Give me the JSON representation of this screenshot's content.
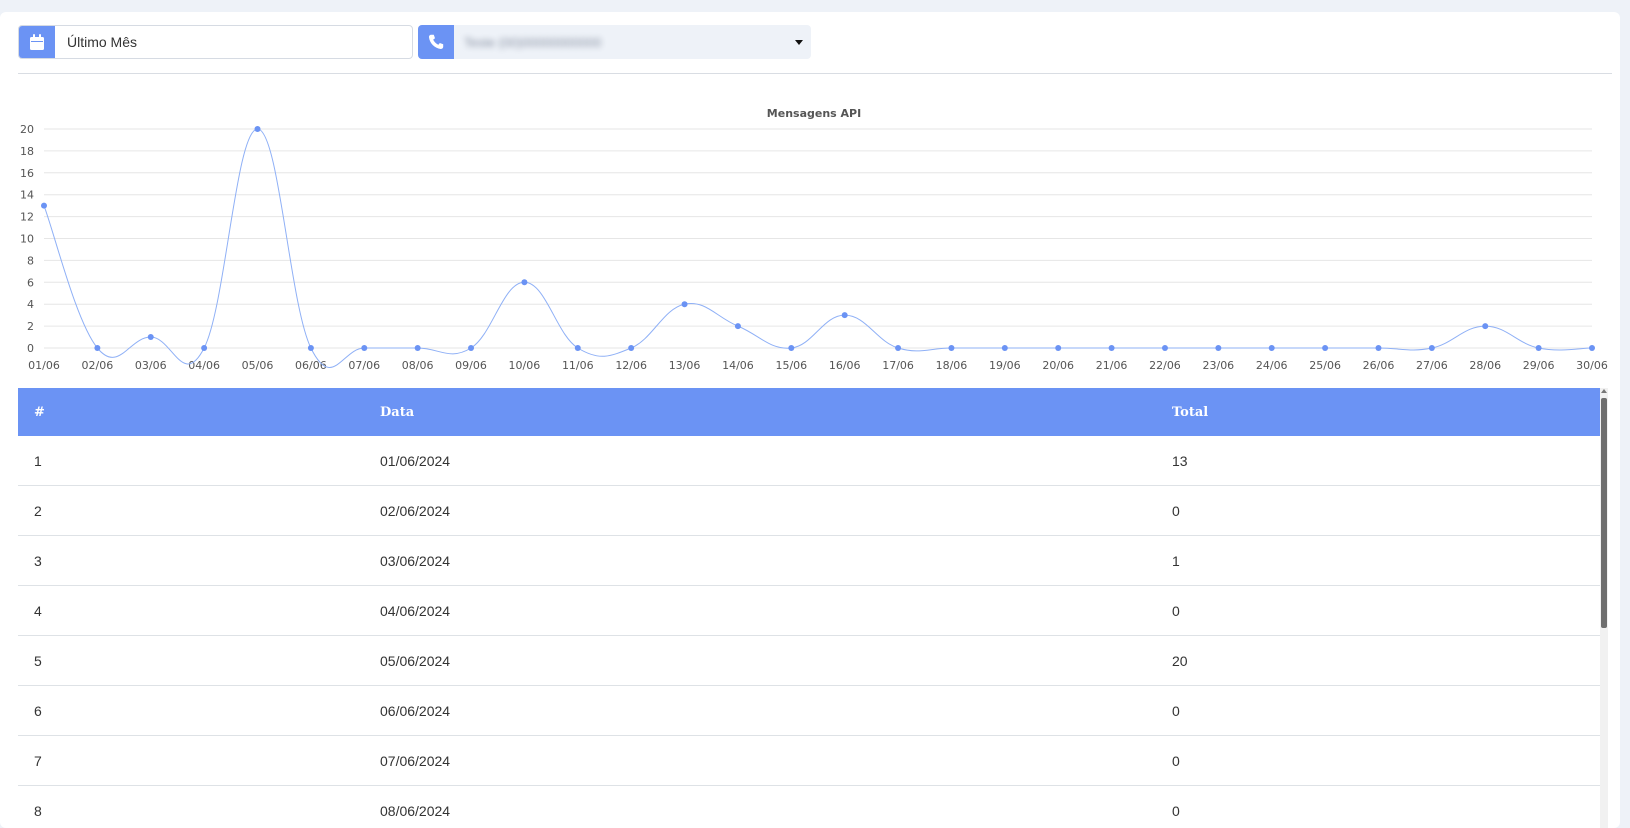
{
  "filters": {
    "period_label": "Último Mês",
    "period_icon": "calendar-icon",
    "phone_label": "Teste (00)00000000000",
    "phone_icon": "phone-icon"
  },
  "colors": {
    "accent": "#6b93f4",
    "line": "#8fb0f6",
    "grid": "#e6e6e6"
  },
  "chart_data": {
    "type": "line",
    "title": "Mensagens API",
    "xlabel": "",
    "ylabel": "",
    "ylim": [
      0,
      20
    ],
    "yticks": [
      0,
      2,
      4,
      6,
      8,
      10,
      12,
      14,
      16,
      18,
      20
    ],
    "grid": true,
    "categories": [
      "01/06",
      "02/06",
      "03/06",
      "04/06",
      "05/06",
      "06/06",
      "07/06",
      "08/06",
      "09/06",
      "10/06",
      "11/06",
      "12/06",
      "13/06",
      "14/06",
      "15/06",
      "16/06",
      "17/06",
      "18/06",
      "19/06",
      "20/06",
      "21/06",
      "22/06",
      "23/06",
      "24/06",
      "25/06",
      "26/06",
      "27/06",
      "28/06",
      "29/06",
      "30/06"
    ],
    "values": [
      13,
      0,
      1,
      0,
      20,
      0,
      0,
      0,
      0,
      6,
      0,
      0,
      4,
      2,
      0,
      3,
      0,
      0,
      0,
      0,
      0,
      0,
      0,
      0,
      0,
      0,
      0,
      2,
      0,
      0
    ]
  },
  "table": {
    "headers": [
      "#",
      "Data",
      "Total"
    ],
    "rows": [
      [
        "1",
        "01/06/2024",
        "13"
      ],
      [
        "2",
        "02/06/2024",
        "0"
      ],
      [
        "3",
        "03/06/2024",
        "1"
      ],
      [
        "4",
        "04/06/2024",
        "0"
      ],
      [
        "5",
        "05/06/2024",
        "20"
      ],
      [
        "6",
        "06/06/2024",
        "0"
      ],
      [
        "7",
        "07/06/2024",
        "0"
      ],
      [
        "8",
        "08/06/2024",
        "0"
      ]
    ]
  }
}
